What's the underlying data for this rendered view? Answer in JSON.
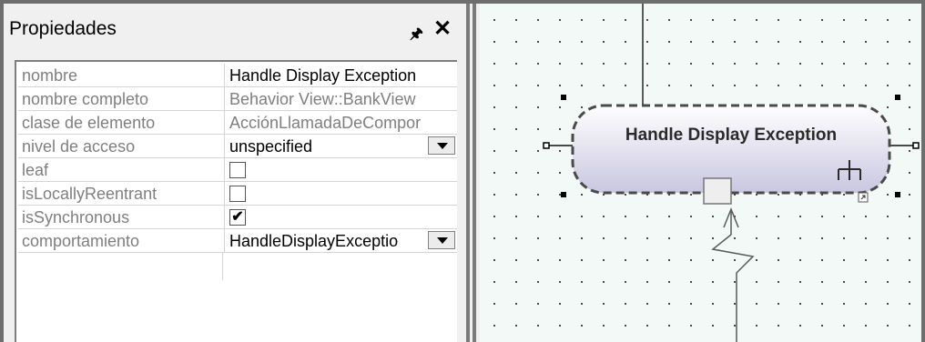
{
  "panel": {
    "title": "Propiedades",
    "pin_icon": "pin-icon",
    "close_icon": "close-icon",
    "properties": [
      {
        "name": "nombre",
        "value": "Handle Display Exception",
        "kind": "text"
      },
      {
        "name": "nombre completo",
        "value": "Behavior View::BankView",
        "kind": "readonly"
      },
      {
        "name": "clase de elemento",
        "value": "AcciónLlamadaDeCompor",
        "kind": "readonly"
      },
      {
        "name": "nivel de acceso",
        "value": "unspecified",
        "kind": "dropdown"
      },
      {
        "name": "leaf",
        "value": "",
        "kind": "checkbox",
        "checked": false
      },
      {
        "name": "isLocallyReentrant",
        "value": "",
        "kind": "checkbox",
        "checked": false
      },
      {
        "name": "isSynchronous",
        "value": "",
        "kind": "checkbox",
        "checked": true
      },
      {
        "name": "comportamiento",
        "value": "HandleDisplayExceptio",
        "kind": "dropdown"
      }
    ]
  },
  "diagram": {
    "action_label": "Handle Display Exception",
    "colors": {
      "canvas": "#f2f9f7",
      "node_top": "#ffffff",
      "node_bottom": "#c9c6e0",
      "border": "#4a4a4a"
    }
  }
}
